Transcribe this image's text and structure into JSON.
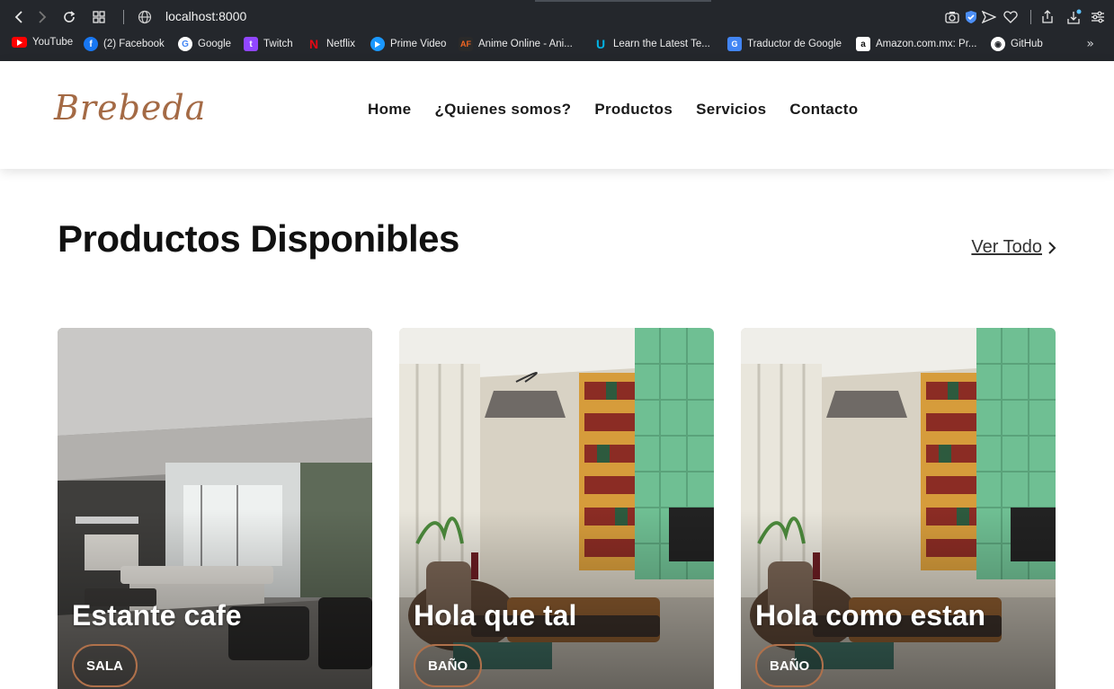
{
  "browser": {
    "url": "localhost:8000",
    "bookmarks": [
      {
        "label": "YouTube",
        "icon": "youtube-icon",
        "color": "#ff0000"
      },
      {
        "label": "(2) Facebook",
        "icon": "facebook-icon",
        "color": "#1877f2"
      },
      {
        "label": "Google",
        "icon": "google-icon",
        "color": "#ffffff"
      },
      {
        "label": "Twitch",
        "icon": "twitch-icon",
        "color": "#9146ff"
      },
      {
        "label": "Netflix",
        "icon": "netflix-icon",
        "color": "#e50914"
      },
      {
        "label": "Prime Video",
        "icon": "prime-video-icon",
        "color": "#00a8e1"
      },
      {
        "label": "Anime Online - Ani...",
        "icon": "animeflv-icon",
        "color": "#f26522"
      },
      {
        "label": "Learn the Latest Te...",
        "icon": "udacity-icon",
        "color": "#02b3e4"
      },
      {
        "label": "Traductor de Google",
        "icon": "google-translate-icon",
        "color": "#4285f4"
      },
      {
        "label": "Amazon.com.mx: Pr...",
        "icon": "amazon-icon",
        "color": "#ffffff"
      },
      {
        "label": "GitHub",
        "icon": "github-icon",
        "color": "#ffffff"
      }
    ]
  },
  "site": {
    "logo": "Brebeda",
    "nav": [
      "Home",
      "¿Quienes somos?",
      "Productos",
      "Servicios",
      "Contacto"
    ]
  },
  "products": {
    "title": "Productos Disponibles",
    "view_all": "Ver Todo",
    "items": [
      {
        "name": "Estante cafe",
        "tag": "SALA"
      },
      {
        "name": "Hola que tal",
        "tag": "BAÑO"
      },
      {
        "name": "Hola como estan",
        "tag": "BAÑO"
      }
    ]
  },
  "colors": {
    "accent": "#b0714b",
    "logo": "#a46a45",
    "chrome": "#24272c"
  }
}
